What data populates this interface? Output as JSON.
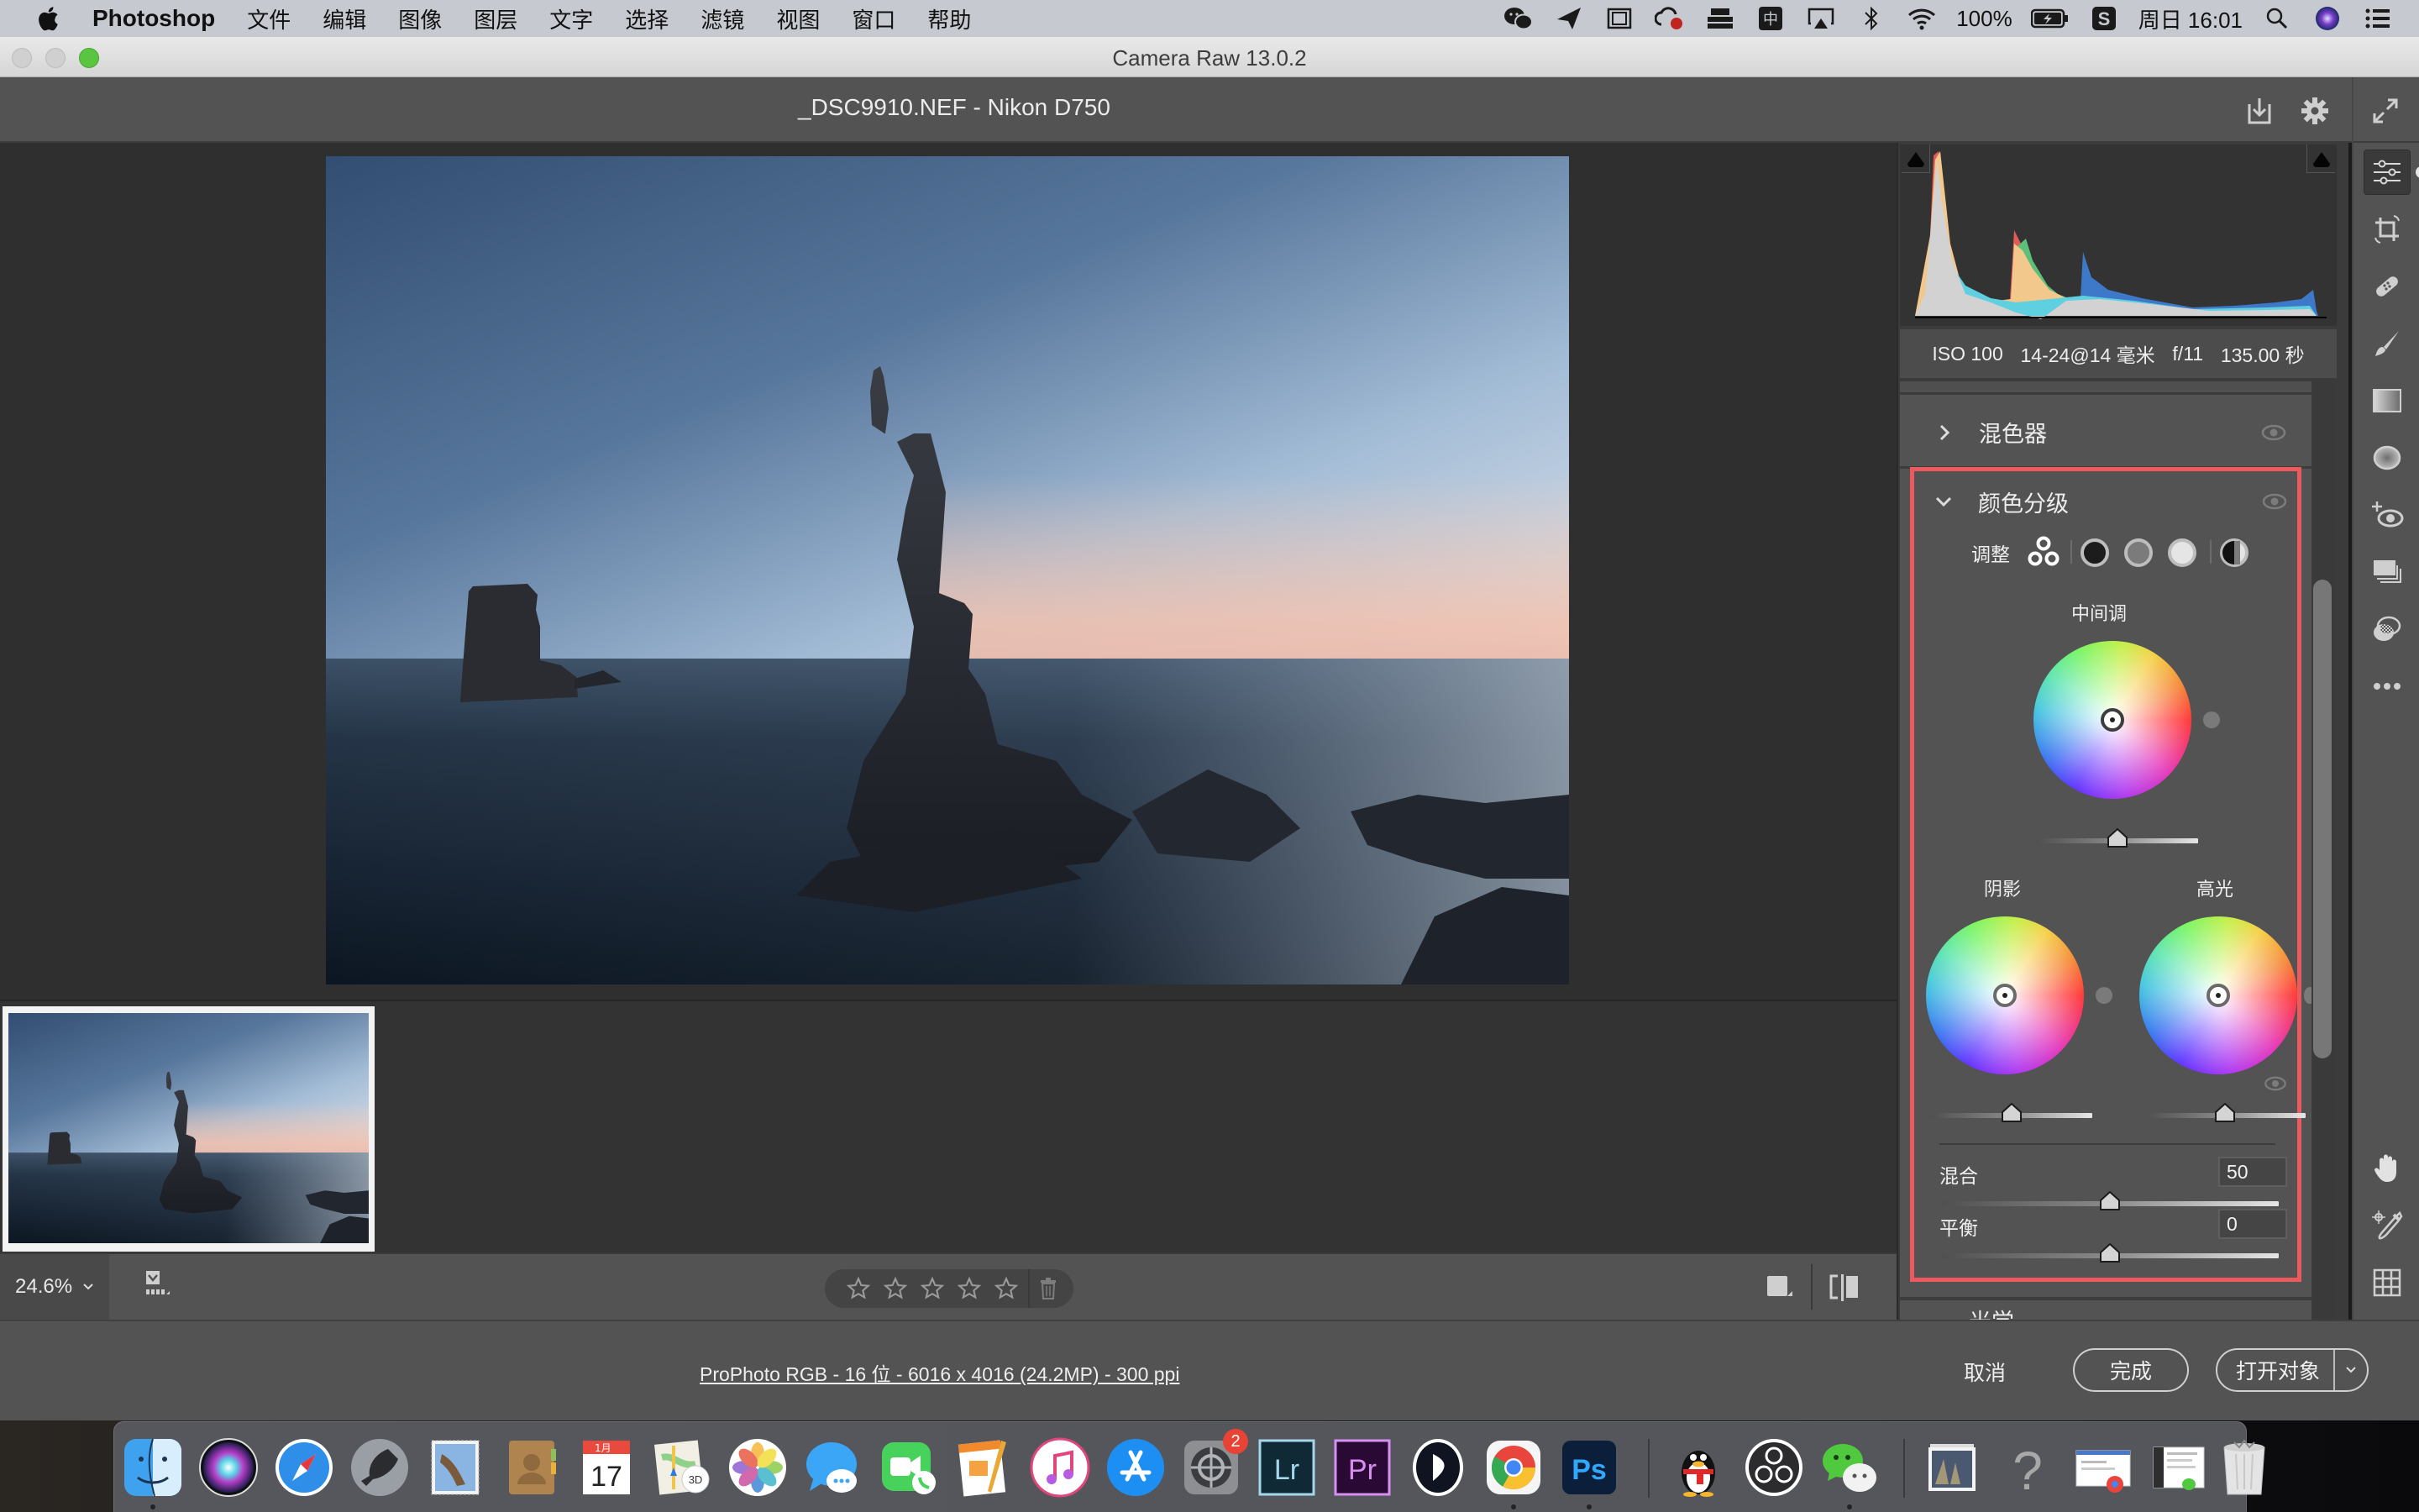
{
  "menubar": {
    "app_name": "Photoshop",
    "menus": [
      "文件",
      "编辑",
      "图像",
      "图层",
      "文字",
      "选择",
      "滤镜",
      "视图",
      "窗口",
      "帮助"
    ],
    "status": {
      "icons": [
        "wechat-icon",
        "paper-plane-icon",
        "window-icon",
        "creative-cloud-icon",
        "dock-icon",
        "input-method-icon",
        "airplay-icon",
        "bluetooth-icon",
        "wifi-icon"
      ],
      "battery": "100%",
      "clock": "周日 16:01"
    }
  },
  "window": {
    "title": "Camera Raw 13.0.2"
  },
  "header": {
    "filename": "_DSC9910.NEF -  Nikon D750"
  },
  "histogram": {
    "exif": {
      "iso": "ISO 100",
      "lens": "14-24@14 毫米",
      "aperture": "f/11",
      "shutter": "135.00 秒"
    }
  },
  "panels": {
    "mixer": {
      "label": "混色器",
      "expanded": false
    },
    "color_grading": {
      "label": "颜色分级",
      "expanded": true,
      "adjust_label": "调整",
      "adjust_modes": [
        "three-way-icon",
        "shadows-mode-icon",
        "midtones-mode-icon",
        "highlights-mode-icon",
        "global-mode-icon"
      ],
      "midtones": {
        "label": "中间调",
        "hue": 0,
        "saturation": 0,
        "luminance": 0
      },
      "shadows": {
        "label": "阴影",
        "hue": 0,
        "saturation": 0,
        "luminance": 0
      },
      "highlights": {
        "label": "高光",
        "hue": 0,
        "saturation": 0,
        "luminance": 0
      },
      "blending": {
        "label": "混合",
        "value": "50"
      },
      "balance": {
        "label": "平衡",
        "value": "0"
      }
    },
    "optics": {
      "label": "光学"
    }
  },
  "tools": [
    "edit-icon",
    "crop-rotate-icon",
    "spot-removal-icon",
    "adjustment-brush-icon",
    "graduated-filter-icon",
    "radial-filter-icon",
    "red-eye-icon",
    "snapshots-icon",
    "presets-icon",
    "more-icon"
  ],
  "bottom_tools": [
    "hand-icon",
    "color-sampler-icon",
    "grid-icon"
  ],
  "viewbar": {
    "zoom": "24.6%",
    "rating_stars": 5,
    "rating_value": 0
  },
  "footer": {
    "workflow": "ProPhoto RGB - 16 位 - 6016 x 4016 (24.2MP) - 300 ppi",
    "cancel": "取消",
    "done": "完成",
    "open": "打开对象"
  },
  "dock": {
    "apps": [
      {
        "name": "finder",
        "running": true
      },
      {
        "name": "siri",
        "running": false
      },
      {
        "name": "safari",
        "running": false
      },
      {
        "name": "launchpad",
        "running": false
      },
      {
        "name": "mail",
        "running": false
      },
      {
        "name": "contacts",
        "running": false
      },
      {
        "name": "calendar",
        "running": false,
        "month": "1月",
        "day": "17"
      },
      {
        "name": "maps",
        "running": false
      },
      {
        "name": "photos",
        "running": false
      },
      {
        "name": "messages",
        "running": false
      },
      {
        "name": "facetime",
        "running": false
      },
      {
        "name": "pages",
        "running": false
      },
      {
        "name": "itunes",
        "running": false
      },
      {
        "name": "app-store",
        "running": false
      },
      {
        "name": "system-preferences",
        "running": false,
        "badge": "2"
      },
      {
        "name": "lightroom",
        "running": false,
        "label": "Lr"
      },
      {
        "name": "premiere",
        "running": false,
        "label": "Pr"
      },
      {
        "name": "infuse",
        "running": false
      },
      {
        "name": "chrome",
        "running": true
      },
      {
        "name": "photoshop",
        "running": true,
        "label": "Ps"
      },
      {
        "name": "qq",
        "running": false
      },
      {
        "name": "obs",
        "running": false
      },
      {
        "name": "wechat",
        "running": true
      },
      {
        "name": "image-stack",
        "running": false
      },
      {
        "name": "help",
        "running": false,
        "label": "?"
      },
      {
        "name": "chrome-window",
        "running": false
      },
      {
        "name": "wechat-window",
        "running": false
      },
      {
        "name": "trash",
        "running": false
      }
    ]
  },
  "colors": {
    "highlight_border": "#ec5a5d",
    "panel_bg": "#535353",
    "canvas_bg": "#2f2f2f"
  }
}
